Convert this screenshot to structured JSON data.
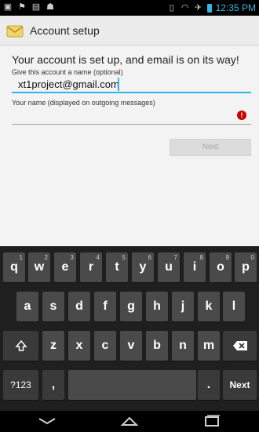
{
  "status_bar": {
    "time": "12:35 PM",
    "icons": [
      "image-icon",
      "flag-icon",
      "clipboard-icon",
      "android-icon",
      "vibrate-icon",
      "wifi-icon",
      "airplane-icon",
      "battery-icon"
    ]
  },
  "app_bar": {
    "title": "Account setup",
    "icon": "email-envelope-icon"
  },
  "form": {
    "headline": "Your account is set up, and email is on its way!",
    "account_name_label": "Give this account a name (optional)",
    "account_name_value": "xt1project@gmail.com",
    "your_name_label": "Your name (displayed on outgoing messages)",
    "your_name_value": "",
    "next_label": "Next"
  },
  "keyboard": {
    "row1": [
      {
        "key": "q",
        "hint": "1"
      },
      {
        "key": "w",
        "hint": "2"
      },
      {
        "key": "e",
        "hint": "3"
      },
      {
        "key": "r",
        "hint": "4"
      },
      {
        "key": "t",
        "hint": "5"
      },
      {
        "key": "y",
        "hint": "6"
      },
      {
        "key": "u",
        "hint": "7"
      },
      {
        "key": "i",
        "hint": "8"
      },
      {
        "key": "o",
        "hint": "9"
      },
      {
        "key": "p",
        "hint": "0"
      }
    ],
    "row2": [
      "a",
      "s",
      "d",
      "f",
      "g",
      "h",
      "j",
      "k",
      "l"
    ],
    "row3": [
      "z",
      "x",
      "c",
      "v",
      "b",
      "n",
      "m"
    ],
    "symbols_label": "?123",
    "comma": ",",
    "period": ".",
    "action_label": "Next"
  },
  "colors": {
    "accent": "#33b5e5",
    "error": "#cc0000",
    "keyboard_bg": "#1f1f1f",
    "key_bg": "#4a4a4a"
  }
}
